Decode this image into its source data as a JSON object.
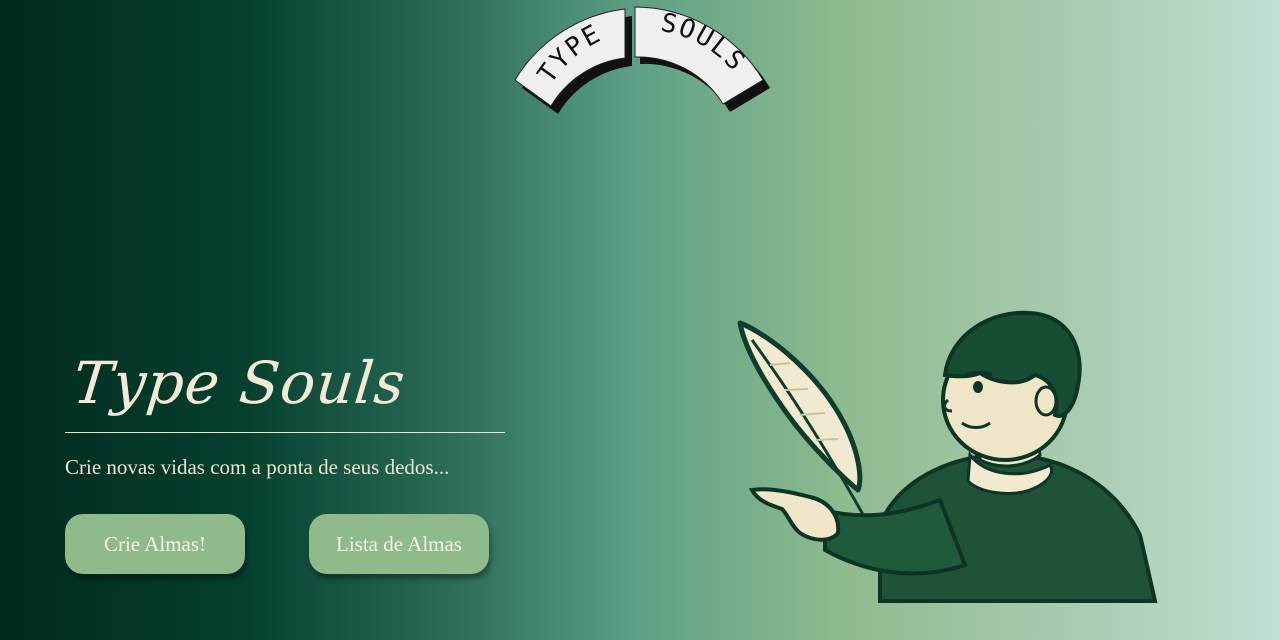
{
  "logo": {
    "left_text": "TYPE",
    "right_text": "SOULS"
  },
  "hero": {
    "title": "Type Souls",
    "tagline": "Crie novas vidas com a ponta de seus dedos..."
  },
  "buttons": {
    "create_label": "Crie Almas!",
    "list_label": "Lista de Almas"
  },
  "colors": {
    "gradient_start": "#022a1f",
    "gradient_end": "#bfe0d2",
    "button_bg": "#8fbb8c",
    "text_cream": "#f1ead6"
  },
  "illustration": {
    "icon": "boy-with-quill-illustration"
  }
}
